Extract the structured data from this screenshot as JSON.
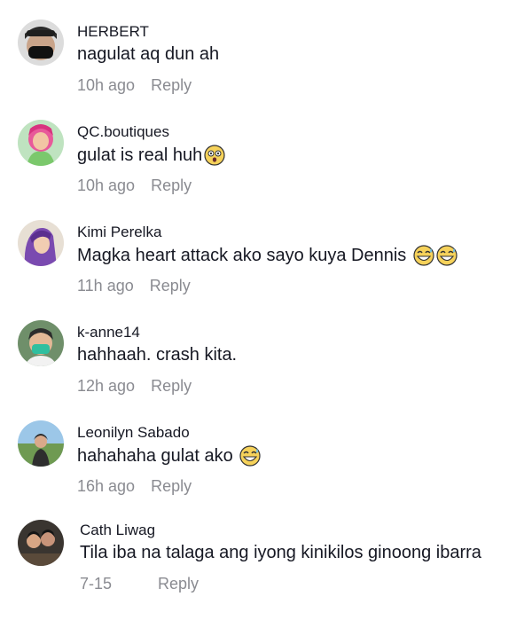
{
  "comments": [
    {
      "username": "HERBERT",
      "text": "nagulat aq dun ah",
      "time": "10h ago",
      "reply_label": "Reply",
      "emojis": []
    },
    {
      "username": "QC.boutiques",
      "text": "gulat is real huh",
      "time": "10h ago",
      "reply_label": "Reply",
      "emojis": [
        "astonished-face-emoji"
      ]
    },
    {
      "username": "Kimi Perelka",
      "text": "Magka heart attack ako sayo kuya Dennis ",
      "time": "11h ago",
      "reply_label": "Reply",
      "emojis": [
        "grinning-sweat-face-emoji",
        "grinning-sweat-face-emoji"
      ]
    },
    {
      "username": "k-anne14",
      "text": "hahhaah. crash kita.",
      "time": "12h ago",
      "reply_label": "Reply",
      "emojis": []
    },
    {
      "username": "Leonilyn Sabado",
      "text": "hahahaha gulat ako ",
      "time": "16h ago",
      "reply_label": "Reply",
      "emojis": [
        "grinning-sweat-face-emoji"
      ]
    },
    {
      "username": "Cath Liwag",
      "text": "Tila iba na talaga ang iyong kinikilos ginoong ibarra",
      "time": "7-15",
      "reply_label": "Reply",
      "emojis": []
    }
  ]
}
